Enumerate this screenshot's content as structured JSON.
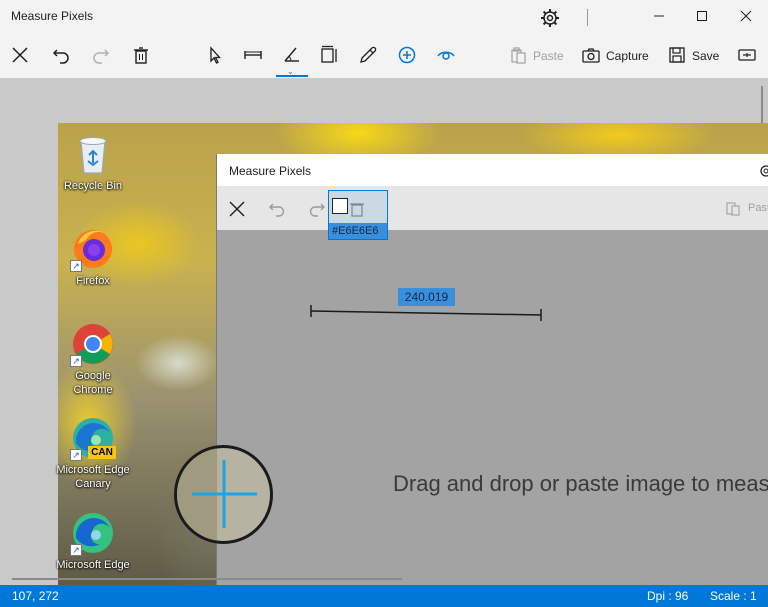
{
  "app": {
    "title": "Measure Pixels"
  },
  "toolbar": {
    "paste_label": "Paste",
    "capture_label": "Capture",
    "save_label": "Save"
  },
  "desktop": {
    "icons": [
      {
        "label": "Recycle Bin"
      },
      {
        "label": "Firefox"
      },
      {
        "label": "Google Chrome"
      },
      {
        "label": "Microsoft Edge Canary",
        "badge": "CAN"
      },
      {
        "label": "Microsoft Edge"
      }
    ]
  },
  "inner_window": {
    "title": "Measure Pixels",
    "paste_label": "Past",
    "color_hex": "#E6E6E6",
    "measurement": "240.019",
    "drop_hint": "Drag and drop or paste image to meas"
  },
  "status": {
    "cursor_position": "107, 272",
    "dpi": "Dpi : 96",
    "scale": "Scale : 1"
  },
  "colors": {
    "accent": "#0078d7",
    "status_bg": "#0078d7",
    "crosshair": "#19a6e8"
  }
}
